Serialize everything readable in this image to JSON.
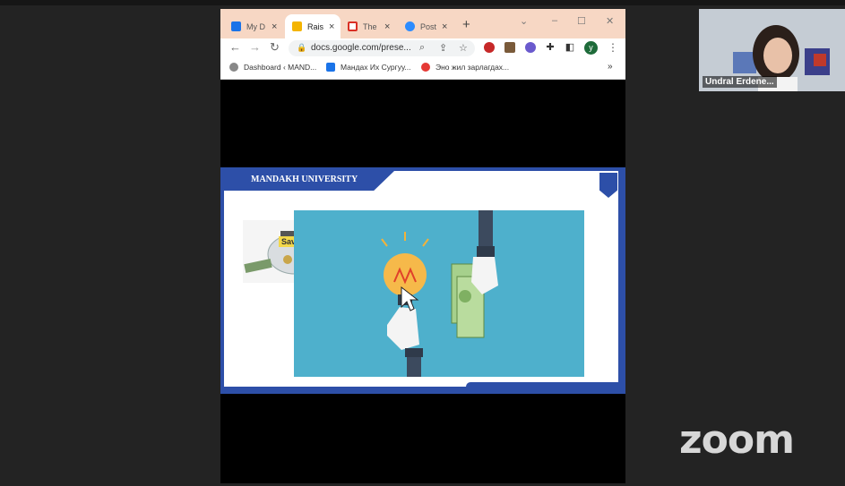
{
  "browser": {
    "tabs": [
      {
        "title": "My D",
        "favicon": "google-drive-icon",
        "color": "#1a73e8"
      },
      {
        "title": "Raise",
        "favicon": "google-slides-icon",
        "color": "#f4b400",
        "active": true
      },
      {
        "title": "The F",
        "favicon": "gmail-icon",
        "color": "#d93025"
      },
      {
        "title": "Post",
        "favicon": "zoom-icon",
        "color": "#2d8cff"
      }
    ],
    "url": "docs.google.com/prese...",
    "bookmarks": [
      {
        "label": "Dashboard ‹ MAND...",
        "icon": "wordpress-icon"
      },
      {
        "label": "Мандах Их Сургуу...",
        "icon": "calendar-icon"
      },
      {
        "label": "Эно жил зарлагдах...",
        "icon": "red-diamond-icon"
      }
    ],
    "bookmarks_more": "»",
    "profile_initial": "y"
  },
  "slide": {
    "banner": "MANDAKH UNIVERSITY",
    "savings_label": "Savings"
  },
  "webcam": {
    "participant_name": "Undral Erdene..."
  },
  "zoom_logo": "zoom",
  "colors": {
    "slide_blue": "#2d4fa8",
    "illustration_bg": "#4eb0cc",
    "tabstrip": "#f7d7c4"
  }
}
